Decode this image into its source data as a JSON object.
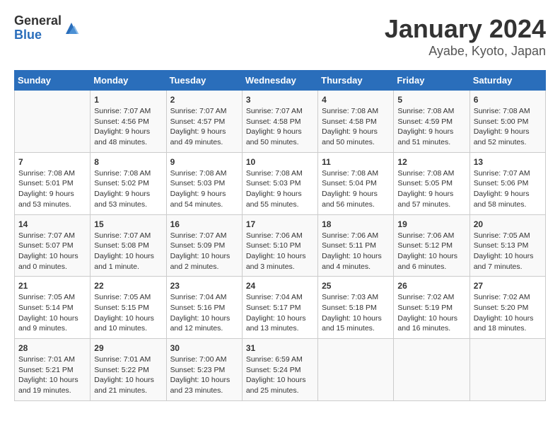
{
  "logo": {
    "general": "General",
    "blue": "Blue"
  },
  "title": "January 2024",
  "subtitle": "Ayabe, Kyoto, Japan",
  "days_of_week": [
    "Sunday",
    "Monday",
    "Tuesday",
    "Wednesday",
    "Thursday",
    "Friday",
    "Saturday"
  ],
  "weeks": [
    [
      {
        "day": "",
        "info": ""
      },
      {
        "day": "1",
        "info": "Sunrise: 7:07 AM\nSunset: 4:56 PM\nDaylight: 9 hours\nand 48 minutes."
      },
      {
        "day": "2",
        "info": "Sunrise: 7:07 AM\nSunset: 4:57 PM\nDaylight: 9 hours\nand 49 minutes."
      },
      {
        "day": "3",
        "info": "Sunrise: 7:07 AM\nSunset: 4:58 PM\nDaylight: 9 hours\nand 50 minutes."
      },
      {
        "day": "4",
        "info": "Sunrise: 7:08 AM\nSunset: 4:58 PM\nDaylight: 9 hours\nand 50 minutes."
      },
      {
        "day": "5",
        "info": "Sunrise: 7:08 AM\nSunset: 4:59 PM\nDaylight: 9 hours\nand 51 minutes."
      },
      {
        "day": "6",
        "info": "Sunrise: 7:08 AM\nSunset: 5:00 PM\nDaylight: 9 hours\nand 52 minutes."
      }
    ],
    [
      {
        "day": "7",
        "info": "Sunrise: 7:08 AM\nSunset: 5:01 PM\nDaylight: 9 hours\nand 53 minutes."
      },
      {
        "day": "8",
        "info": "Sunrise: 7:08 AM\nSunset: 5:02 PM\nDaylight: 9 hours\nand 53 minutes."
      },
      {
        "day": "9",
        "info": "Sunrise: 7:08 AM\nSunset: 5:03 PM\nDaylight: 9 hours\nand 54 minutes."
      },
      {
        "day": "10",
        "info": "Sunrise: 7:08 AM\nSunset: 5:03 PM\nDaylight: 9 hours\nand 55 minutes."
      },
      {
        "day": "11",
        "info": "Sunrise: 7:08 AM\nSunset: 5:04 PM\nDaylight: 9 hours\nand 56 minutes."
      },
      {
        "day": "12",
        "info": "Sunrise: 7:08 AM\nSunset: 5:05 PM\nDaylight: 9 hours\nand 57 minutes."
      },
      {
        "day": "13",
        "info": "Sunrise: 7:07 AM\nSunset: 5:06 PM\nDaylight: 9 hours\nand 58 minutes."
      }
    ],
    [
      {
        "day": "14",
        "info": "Sunrise: 7:07 AM\nSunset: 5:07 PM\nDaylight: 10 hours\nand 0 minutes."
      },
      {
        "day": "15",
        "info": "Sunrise: 7:07 AM\nSunset: 5:08 PM\nDaylight: 10 hours\nand 1 minute."
      },
      {
        "day": "16",
        "info": "Sunrise: 7:07 AM\nSunset: 5:09 PM\nDaylight: 10 hours\nand 2 minutes."
      },
      {
        "day": "17",
        "info": "Sunrise: 7:06 AM\nSunset: 5:10 PM\nDaylight: 10 hours\nand 3 minutes."
      },
      {
        "day": "18",
        "info": "Sunrise: 7:06 AM\nSunset: 5:11 PM\nDaylight: 10 hours\nand 4 minutes."
      },
      {
        "day": "19",
        "info": "Sunrise: 7:06 AM\nSunset: 5:12 PM\nDaylight: 10 hours\nand 6 minutes."
      },
      {
        "day": "20",
        "info": "Sunrise: 7:05 AM\nSunset: 5:13 PM\nDaylight: 10 hours\nand 7 minutes."
      }
    ],
    [
      {
        "day": "21",
        "info": "Sunrise: 7:05 AM\nSunset: 5:14 PM\nDaylight: 10 hours\nand 9 minutes."
      },
      {
        "day": "22",
        "info": "Sunrise: 7:05 AM\nSunset: 5:15 PM\nDaylight: 10 hours\nand 10 minutes."
      },
      {
        "day": "23",
        "info": "Sunrise: 7:04 AM\nSunset: 5:16 PM\nDaylight: 10 hours\nand 12 minutes."
      },
      {
        "day": "24",
        "info": "Sunrise: 7:04 AM\nSunset: 5:17 PM\nDaylight: 10 hours\nand 13 minutes."
      },
      {
        "day": "25",
        "info": "Sunrise: 7:03 AM\nSunset: 5:18 PM\nDaylight: 10 hours\nand 15 minutes."
      },
      {
        "day": "26",
        "info": "Sunrise: 7:02 AM\nSunset: 5:19 PM\nDaylight: 10 hours\nand 16 minutes."
      },
      {
        "day": "27",
        "info": "Sunrise: 7:02 AM\nSunset: 5:20 PM\nDaylight: 10 hours\nand 18 minutes."
      }
    ],
    [
      {
        "day": "28",
        "info": "Sunrise: 7:01 AM\nSunset: 5:21 PM\nDaylight: 10 hours\nand 19 minutes."
      },
      {
        "day": "29",
        "info": "Sunrise: 7:01 AM\nSunset: 5:22 PM\nDaylight: 10 hours\nand 21 minutes."
      },
      {
        "day": "30",
        "info": "Sunrise: 7:00 AM\nSunset: 5:23 PM\nDaylight: 10 hours\nand 23 minutes."
      },
      {
        "day": "31",
        "info": "Sunrise: 6:59 AM\nSunset: 5:24 PM\nDaylight: 10 hours\nand 25 minutes."
      },
      {
        "day": "",
        "info": ""
      },
      {
        "day": "",
        "info": ""
      },
      {
        "day": "",
        "info": ""
      }
    ]
  ]
}
